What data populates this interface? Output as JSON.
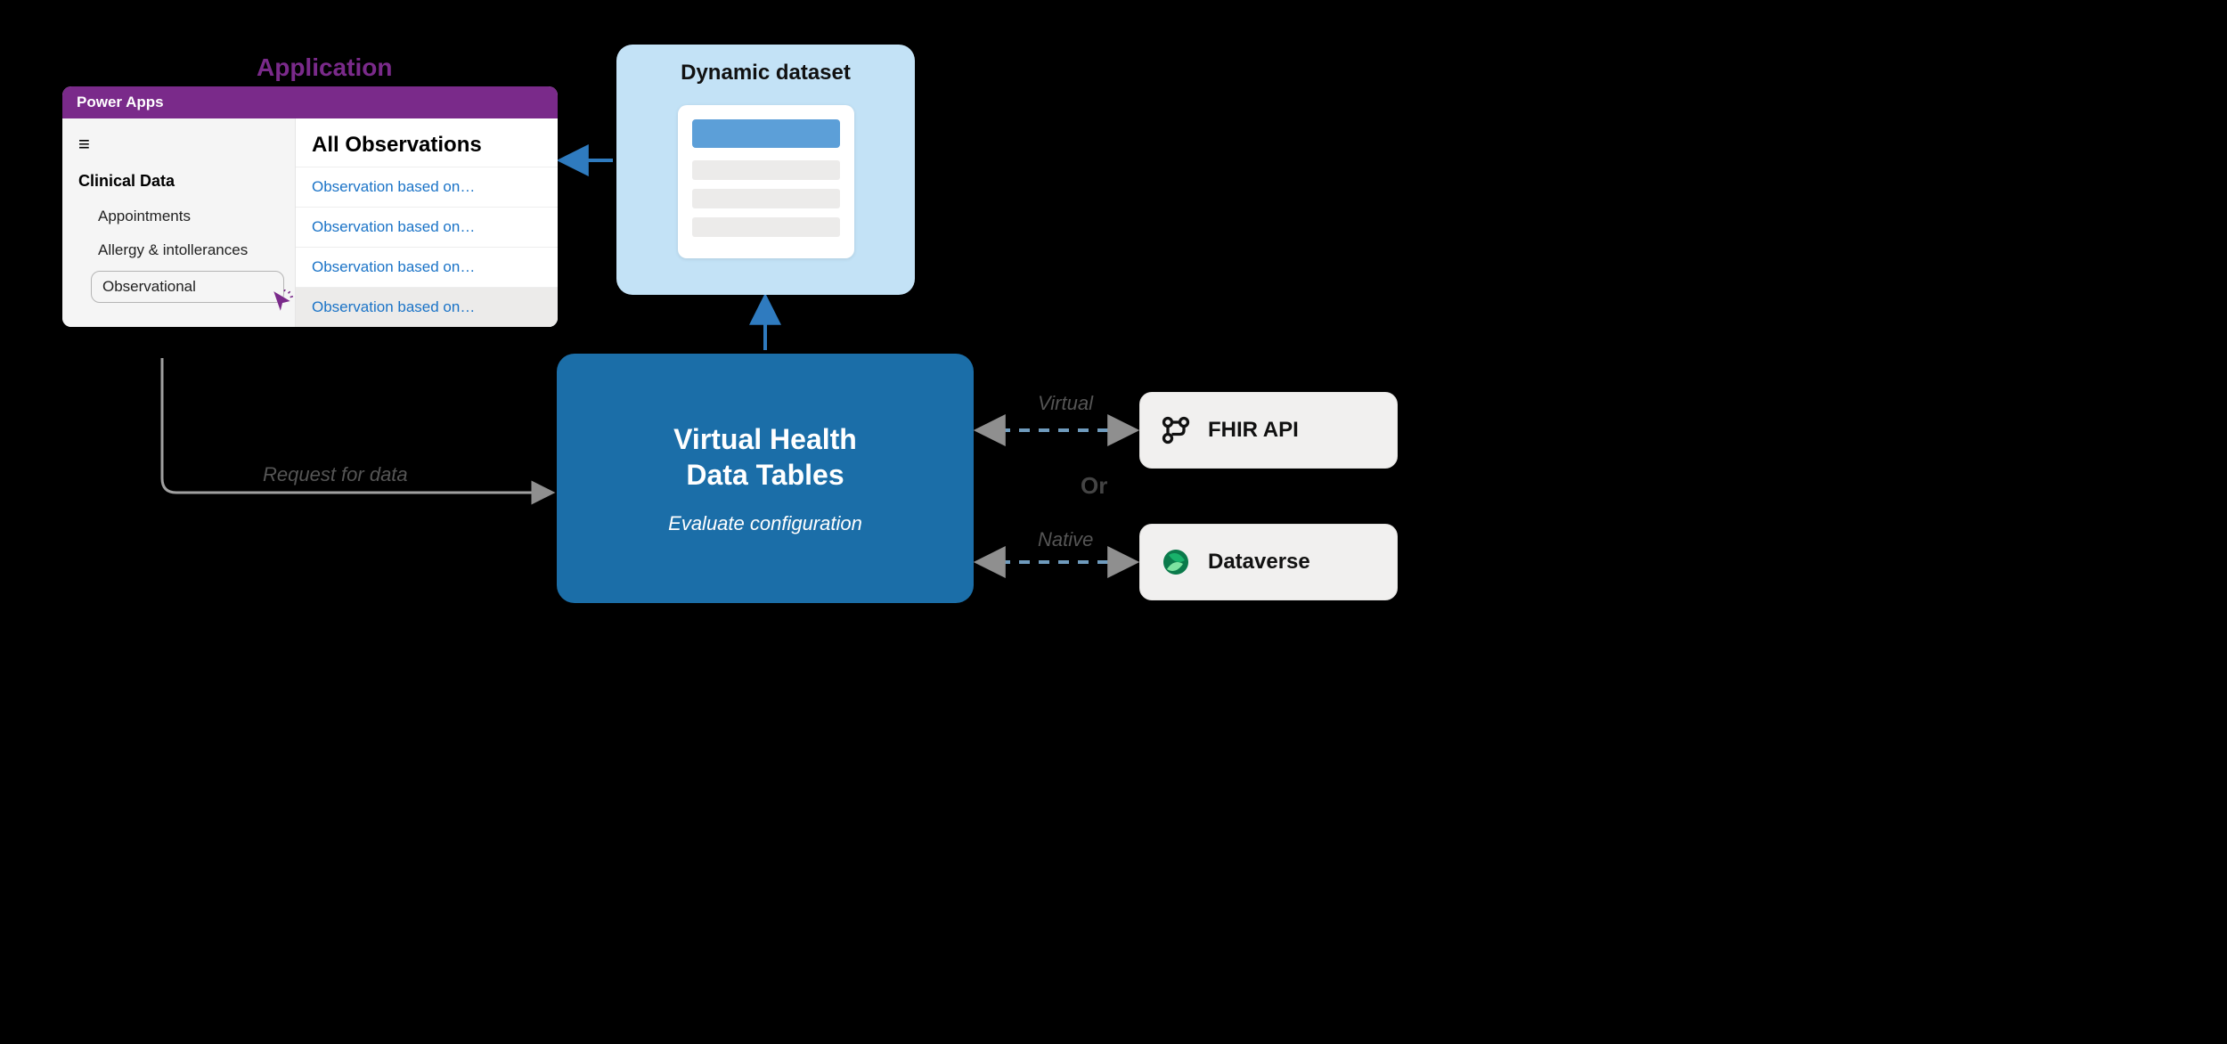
{
  "labels": {
    "application": "Application",
    "dynamic_dataset": "Dynamic dataset",
    "vhdt_line1": "Virtual Health",
    "vhdt_line2": "Data Tables",
    "vhdt_sub": "Evaluate configuration",
    "request": "Request for data",
    "virtual": "Virtual",
    "native": "Native",
    "or": "Or",
    "fhir": "FHIR API",
    "dataverse": "Dataverse"
  },
  "app": {
    "titlebar": "Power Apps",
    "sidebar_heading": "Clinical Data",
    "sidebar_items": [
      "Appointments",
      "Allergy & intollerances",
      "Observational"
    ],
    "main_heading": "All Observations",
    "rows": [
      "Observation based on…",
      "Observation based on…",
      "Observation based on…",
      "Observation based on…"
    ]
  }
}
